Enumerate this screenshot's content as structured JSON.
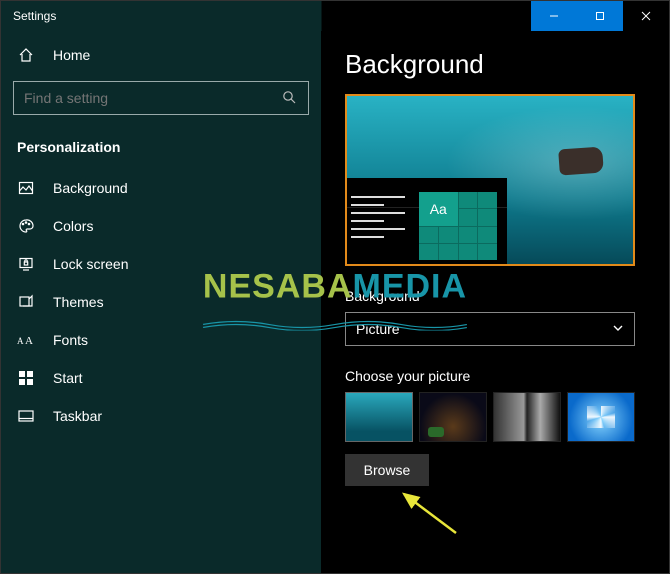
{
  "window": {
    "title": "Settings"
  },
  "sidebar": {
    "home": "Home",
    "search_placeholder": "Find a setting",
    "section": "Personalization",
    "items": [
      {
        "label": "Background"
      },
      {
        "label": "Colors"
      },
      {
        "label": "Lock screen"
      },
      {
        "label": "Themes"
      },
      {
        "label": "Fonts"
      },
      {
        "label": "Start"
      },
      {
        "label": "Taskbar"
      }
    ]
  },
  "page": {
    "title": "Background",
    "preview_sample_text": "Aa",
    "background_label": "Background",
    "background_value": "Picture",
    "choose_label": "Choose your picture",
    "browse_label": "Browse"
  },
  "watermark": {
    "part1": "NESABA",
    "part2": "MEDIA"
  },
  "colors": {
    "accent": "#0078d7",
    "highlight_border": "#e28a1a"
  }
}
